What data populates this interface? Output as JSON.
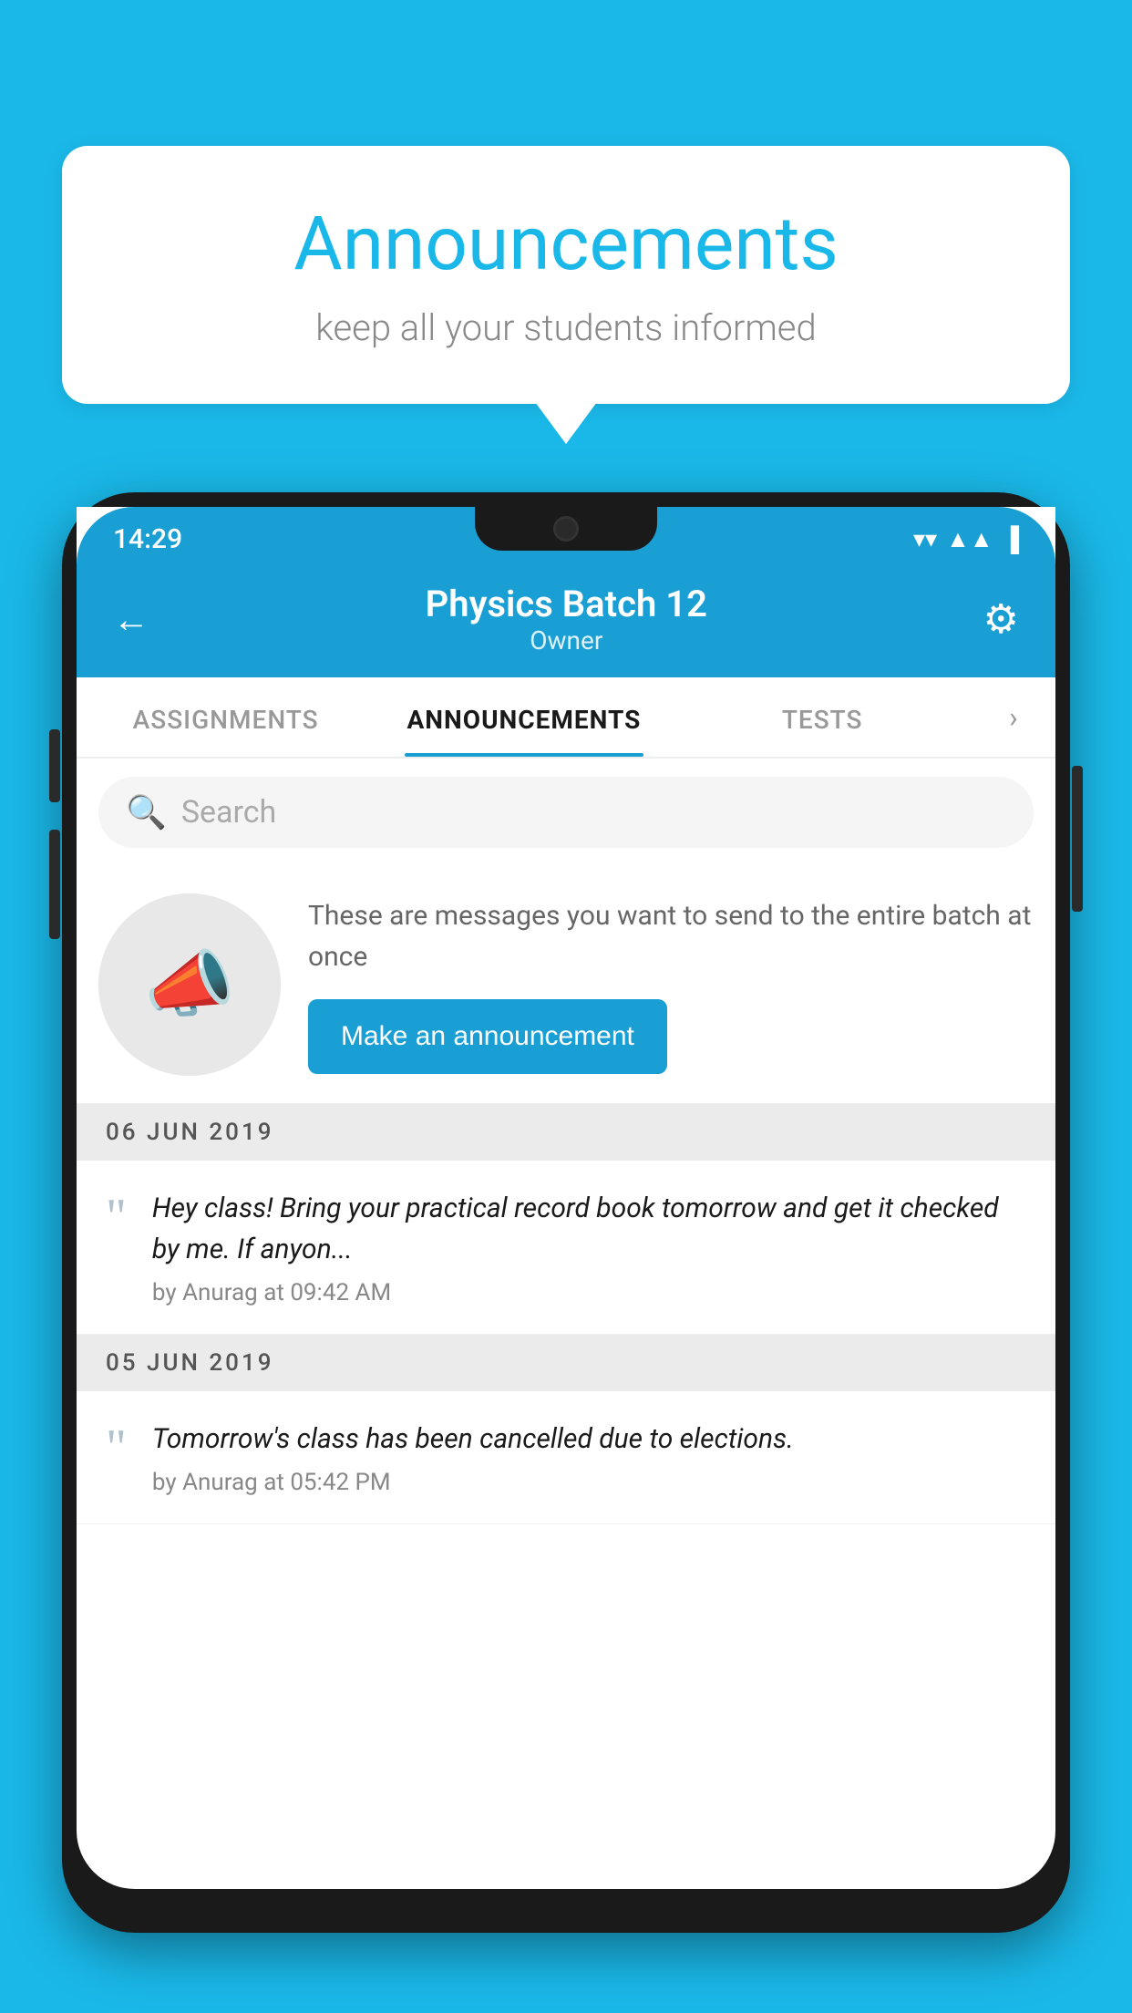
{
  "background_color": "#1ab8e8",
  "speech_bubble": {
    "title": "Announcements",
    "subtitle": "keep all your students informed"
  },
  "phone": {
    "status_bar": {
      "time": "14:29",
      "wifi": "▼",
      "signal": "▲",
      "battery": "▐"
    },
    "header": {
      "back_label": "←",
      "title": "Physics Batch 12",
      "subtitle": "Owner",
      "gear_label": "⚙"
    },
    "tabs": [
      {
        "label": "ASSIGNMENTS",
        "active": false
      },
      {
        "label": "ANNOUNCEMENTS",
        "active": true
      },
      {
        "label": "TESTS",
        "active": false
      }
    ],
    "search": {
      "placeholder": "Search"
    },
    "promo": {
      "description": "These are messages you want to send to the entire batch at once",
      "button_label": "Make an announcement"
    },
    "announcements": [
      {
        "date": "06  JUN  2019",
        "text": "Hey class! Bring your practical record book tomorrow and get it checked by me. If anyon...",
        "meta": "by Anurag at 09:42 AM"
      },
      {
        "date": "05  JUN  2019",
        "text": "Tomorrow's class has been cancelled due to elections.",
        "meta": "by Anurag at 05:42 PM"
      }
    ]
  }
}
